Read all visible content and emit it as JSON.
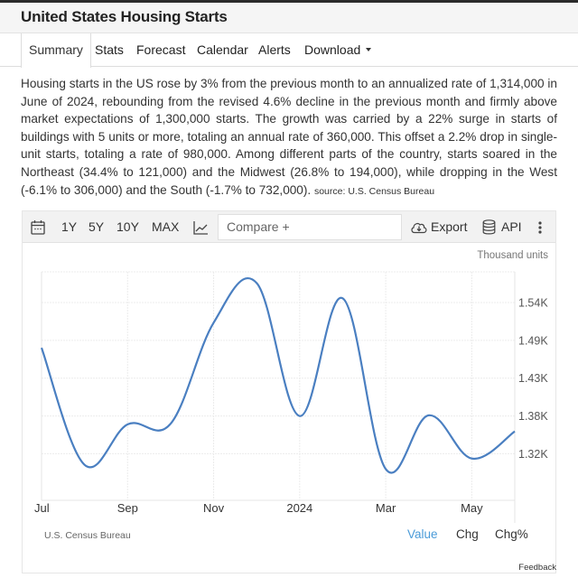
{
  "page": {
    "title": "United States Housing Starts"
  },
  "tabs": [
    {
      "label": "Summary",
      "active": true
    },
    {
      "label": "Stats"
    },
    {
      "label": "Forecast"
    },
    {
      "label": "Calendar"
    },
    {
      "label": "Alerts"
    },
    {
      "label": "Download"
    }
  ],
  "summary": {
    "text": "Housing starts in the US rose by 3% from the previous month to an annualized rate of 1,314,000 in June of 2024, rebounding from the revised 4.6% decline in the previous month and firmly above market expectations of 1,300,000 starts. The growth was carried by a 22% surge in starts of buildings with 5 units or more, totaling an annual rate of 360,000. This offset a 2.2% drop in single-unit starts, totaling a rate of 980,000. Among different parts of the country, starts soared in the Northeast (34.4% to 121,000) and the Midwest (26.8% to 194,000), while dropping in the West (-6.1% to 306,000) and the South (-1.7% to 732,000).",
    "source": "source: U.S. Census Bureau"
  },
  "toolbar": {
    "calendar_icon": "calendar-icon",
    "ranges": [
      "1Y",
      "5Y",
      "10Y",
      "MAX"
    ],
    "chart_type_icon": "line-chart-icon",
    "compare_placeholder": "Compare +",
    "export_label": "Export",
    "export_icon": "cloud-download-icon",
    "api_label": "API",
    "api_icon": "database-icon",
    "more_icon": "vertical-ellipsis-icon"
  },
  "chart_footer": {
    "source": "U.S. Census Bureau",
    "modes": [
      {
        "label": "Value",
        "active": true
      },
      {
        "label": "Chg"
      },
      {
        "label": "Chg%"
      }
    ],
    "feedback": "Feedback"
  },
  "colors": {
    "line": "#4a7fc1",
    "active_mode": "#4a9bd8"
  },
  "chart_data": {
    "type": "line",
    "title": "",
    "units_label": "Thousand units",
    "xlabel": "",
    "ylabel": "",
    "x": [
      "Jul 2023",
      "Aug 2023",
      "Sep 2023",
      "Oct 2023",
      "Nov 2023",
      "Dec 2023",
      "Jan 2024",
      "Feb 2024",
      "Mar 2024",
      "Apr 2024",
      "May 2024",
      "Jun 2024"
    ],
    "series": [
      {
        "name": "Housing Starts",
        "values": [
          1475,
          1307,
          1365,
          1366,
          1511,
          1568,
          1377,
          1546,
          1301,
          1378,
          1316,
          1355
        ]
      }
    ],
    "x_tick_labels": [
      "Jul",
      "Sep",
      "Nov",
      "2024",
      "Mar",
      "May"
    ],
    "x_tick_indices": [
      0,
      2,
      4,
      6,
      8,
      10
    ],
    "y_tick_labels": [
      "1.54K",
      "1.49K",
      "1.43K",
      "1.38K",
      "1.32K"
    ],
    "y_tick_values": [
      1540,
      1485.7,
      1431.4,
      1377.1,
      1322.9
    ],
    "ylim": [
      1256,
      1584
    ],
    "grid": true,
    "y_axis_side": "right",
    "smooth": true
  }
}
